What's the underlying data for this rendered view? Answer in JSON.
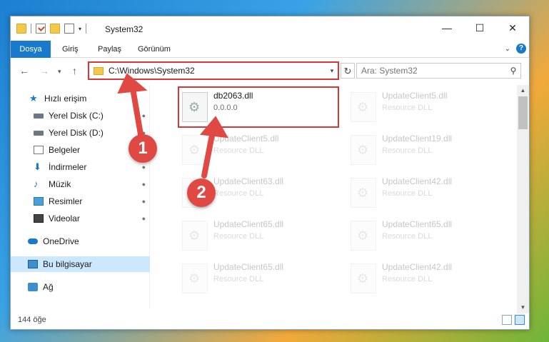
{
  "window": {
    "title": "System32",
    "controls": {
      "minimize": "—",
      "maximize": "☐",
      "close": "✕"
    }
  },
  "ribbon": {
    "tabs": [
      "Dosya",
      "Giriş",
      "Paylaş",
      "Görünüm"
    ],
    "active_tab": "Dosya",
    "accent": "#1979ca"
  },
  "nav": {
    "back": "←",
    "forward": "→",
    "recent": "▾",
    "up": "↑",
    "address": "C:\\Windows\\System32",
    "address_caret": "▾",
    "refresh": "↻",
    "search_placeholder": "Ara: System32",
    "search_icon": "⚲"
  },
  "sidebar": {
    "items": [
      {
        "label": "Hızlı erişim",
        "icon": "star-icon"
      },
      {
        "label": "Yerel Disk (C:)",
        "icon": "drive-icon",
        "pinned": true
      },
      {
        "label": "Yerel Disk (D:)",
        "icon": "drive-icon",
        "pinned": true
      },
      {
        "label": "Belgeler",
        "icon": "document-icon",
        "pinned": true
      },
      {
        "label": "İndirmeler",
        "icon": "download-icon",
        "pinned": true
      },
      {
        "label": "Müzik",
        "icon": "music-icon",
        "pinned": true
      },
      {
        "label": "Resimler",
        "icon": "pictures-icon",
        "pinned": true
      },
      {
        "label": "Videolar",
        "icon": "video-icon",
        "pinned": true
      },
      {
        "label": "OneDrive",
        "icon": "cloud-icon"
      },
      {
        "label": "Bu bilgisayar",
        "icon": "computer-icon",
        "selected": true
      },
      {
        "label": "Ağ",
        "icon": "network-icon"
      }
    ],
    "pin_glyph": "📌"
  },
  "files": [
    {
      "name": "db2063.dll",
      "sub": "0.0.0.0",
      "highlighted": true
    },
    {
      "name": "UpdateClient5.dll",
      "sub": "Resource DLL"
    },
    {
      "name": "UpdateClient5.dll",
      "sub": "Resource DLL"
    },
    {
      "name": "UpdateClient19.dll",
      "sub": "Resource DLL"
    },
    {
      "name": "UpdateClient63.dll",
      "sub": "Resource DLL"
    },
    {
      "name": "UpdateClient42.dll",
      "sub": "Resource DLL"
    },
    {
      "name": "UpdateClient65.dll",
      "sub": "Resource DLL"
    },
    {
      "name": "UpdateClient65.dll",
      "sub": "Resource DLL"
    },
    {
      "name": "UpdateClient65.dll",
      "sub": "Resource DLL"
    },
    {
      "name": "UpdateClient42.dll",
      "sub": "Resource DLL"
    }
  ],
  "status": {
    "count": "144 öğe"
  },
  "annotations": {
    "badge1": "1",
    "badge2": "2",
    "color": "#e04844"
  }
}
